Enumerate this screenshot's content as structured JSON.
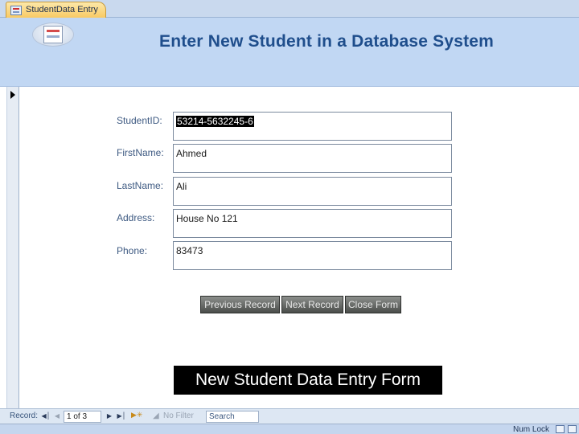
{
  "tab": {
    "label": "StudentData Entry"
  },
  "header": {
    "title": "Enter New Student in a Database System"
  },
  "fields": [
    {
      "label": "StudentID:",
      "value": "53214-5632245-6"
    },
    {
      "label": "FirstName:",
      "value": "Ahmed"
    },
    {
      "label": "LastName:",
      "value": "Ali"
    },
    {
      "label": "Address:",
      "value": "House No 121"
    },
    {
      "label": "Phone:",
      "value": "83473"
    }
  ],
  "buttons": {
    "previous": "Previous Record",
    "next": "Next Record",
    "close": "Close Form"
  },
  "caption": "New Student Data Entry Form",
  "navigation": {
    "label": "Record:",
    "first_icon": "first-record-icon",
    "prev_icon": "previous-record-icon",
    "next_icon": "next-record-icon",
    "last_icon": "last-record-icon",
    "new_icon": "new-record-icon",
    "position": "1 of 3",
    "filter_label": "No Filter",
    "search_placeholder": "Search"
  },
  "status": {
    "numlock": "Num Lock"
  }
}
